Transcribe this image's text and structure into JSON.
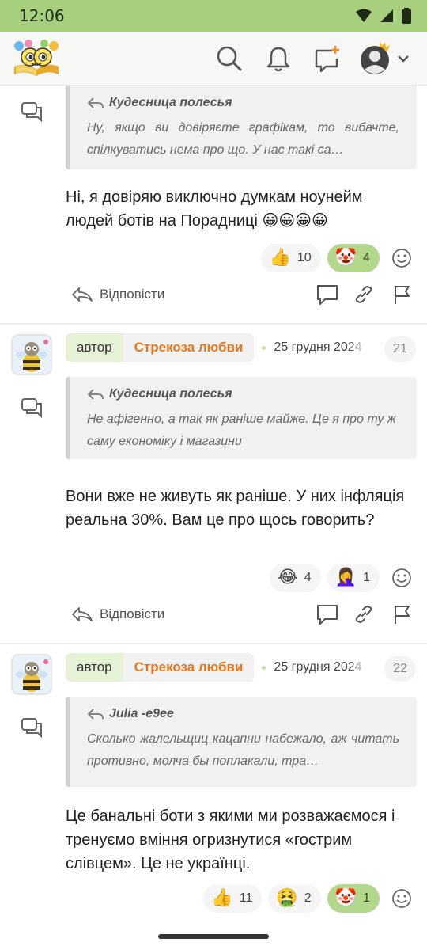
{
  "status": {
    "time": "12:06"
  },
  "header": {
    "logo": "app-logo",
    "icons": [
      "search-icon",
      "bell-icon",
      "new-chat-icon",
      "avatar-icon"
    ]
  },
  "posts": [
    {
      "quote": {
        "author": "Кудесница полесья",
        "text": "Ну, якщо ви довіряєте графікам, то вибачте, спілкуватись нема про що. У нас такі са…"
      },
      "text": "Ні, я довіряю виключно думкам ноунейм людей ботів на Порадниці 😀😀😀😀",
      "reactions": [
        {
          "emoji": "👍",
          "count": "10",
          "active": false
        },
        {
          "emoji": "🤡",
          "count": "4",
          "active": true
        }
      ],
      "reply_label": "Відповісти"
    },
    {
      "author_tag": "автор",
      "author": "Стрекоза любви",
      "date": "25 грудня 2024",
      "number": "21",
      "quote": {
        "author": "Кудесница полесья",
        "text": "Не афігенно, а так як раніше майже. Це я про ту ж саму економіку і магазини"
      },
      "text": "Вони вже не живуть як раніше. У них інфляція реальна 30%. Вам це про щось говорить?",
      "reactions": [
        {
          "emoji": "😂",
          "count": "4",
          "active": false
        },
        {
          "emoji": "🤦‍♀️",
          "count": "1",
          "active": false
        }
      ],
      "reply_label": "Відповісти"
    },
    {
      "author_tag": "автор",
      "author": "Стрекоза любви",
      "date": "25 грудня 2024",
      "number": "22",
      "quote": {
        "author": "Julia -e9ee",
        "text": "Сколько жалельщиц кацапни набежало, аж читать противно, молча бы поплакали, тра…"
      },
      "text": "Це банальні боти з якими ми розважаємося і тренуємо вміння огризнутися «гострим слівцем». Це не українці.",
      "reactions": [
        {
          "emoji": "👍",
          "count": "11",
          "active": false
        },
        {
          "emoji": "🤮",
          "count": "2",
          "active": false
        },
        {
          "emoji": "🤡",
          "count": "1",
          "active": true
        }
      ]
    }
  ],
  "colors": {
    "status_bar": "#a7cf7d",
    "accent_green": "#b3d88c",
    "author_orange": "#e8761c"
  }
}
